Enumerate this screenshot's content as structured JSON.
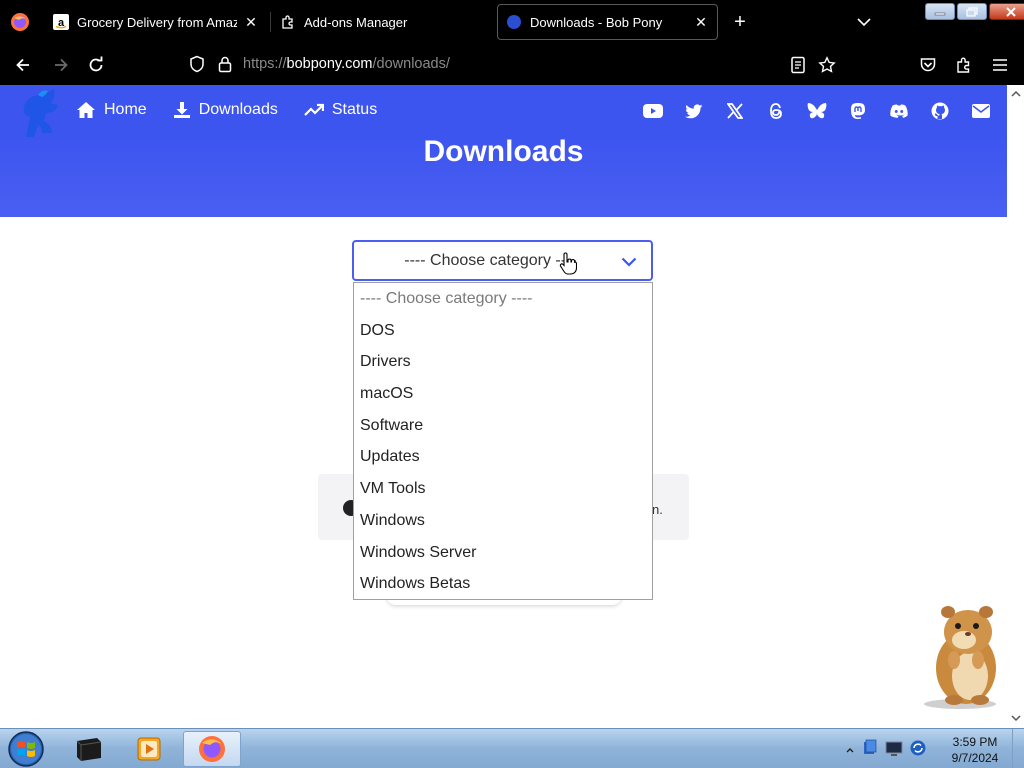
{
  "browser": {
    "tabs": [
      {
        "title": "Grocery Delivery from Amazon",
        "icon": "amazon-icon"
      },
      {
        "title": "Add-ons Manager",
        "icon": "puzzle-icon"
      },
      {
        "title": "Downloads - Bob Pony",
        "icon": "bobpony-icon",
        "active": true
      }
    ],
    "url_scheme": "https://",
    "url_host": "bobpony.com",
    "url_path": "/downloads/"
  },
  "site": {
    "nav": [
      {
        "label": "Home",
        "icon": "home-icon"
      },
      {
        "label": "Downloads",
        "icon": "download-icon"
      },
      {
        "label": "Status",
        "icon": "trending-icon"
      }
    ],
    "social": [
      "youtube-icon",
      "twitter-icon",
      "x-icon",
      "threads-icon",
      "bluesky-icon",
      "mastodon-icon",
      "discord-icon",
      "github-icon",
      "mail-icon"
    ],
    "page_title": "Downloads",
    "brand_color": "#3d55ef",
    "select": {
      "value": "---- Choose category ----",
      "options": [
        "---- Choose category ----",
        "DOS",
        "Drivers",
        "macOS",
        "Software",
        "Updates",
        "VM Tools",
        "Windows",
        "Windows Server",
        "Windows Betas"
      ]
    },
    "info_tail": "n."
  },
  "taskbar": {
    "time": "3:59 PM",
    "date": "9/7/2024"
  }
}
